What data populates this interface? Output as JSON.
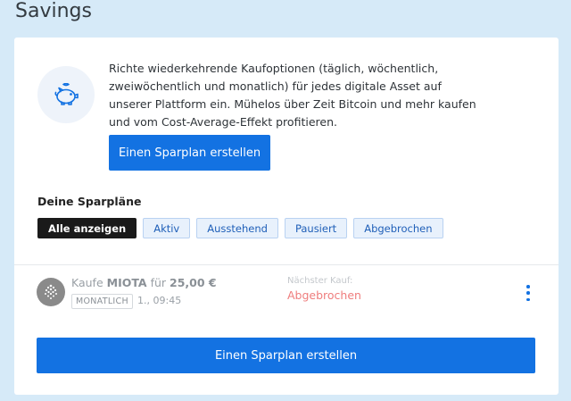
{
  "page": {
    "title": "Savings"
  },
  "intro": {
    "icon": "piggy-bank-icon",
    "text": "Richte wiederkehrende Kaufoptionen (täglich, wöchentlich, zweiwöchentlich und monatlich) für jedes digitale Asset auf unserer Plattform ein. Mühelos über Zeit Bitcoin und mehr kaufen und vom Cost-Average-Effekt profitieren.",
    "create_button": "Einen Sparplan erstellen"
  },
  "plans": {
    "title": "Deine Sparpläne",
    "filters": [
      {
        "label": "Alle anzeigen",
        "active": true
      },
      {
        "label": "Aktiv",
        "active": false
      },
      {
        "label": "Ausstehend",
        "active": false
      },
      {
        "label": "Pausiert",
        "active": false
      },
      {
        "label": "Abgebrochen",
        "active": false
      }
    ],
    "items": [
      {
        "coin_icon": "iota-icon",
        "prefix": "Kaufe",
        "asset": "MIOTA",
        "connector": "für",
        "amount": "25,00 €",
        "frequency": "MONATLICH",
        "date": "1., 09:45",
        "next_label": "Nächster Kauf:",
        "status": "Abgebrochen"
      }
    ],
    "create_button": "Einen Sparplan erstellen"
  },
  "colors": {
    "background": "#d6eaf8",
    "primary": "#1372e2",
    "cancelled": "#ef7d7d"
  }
}
